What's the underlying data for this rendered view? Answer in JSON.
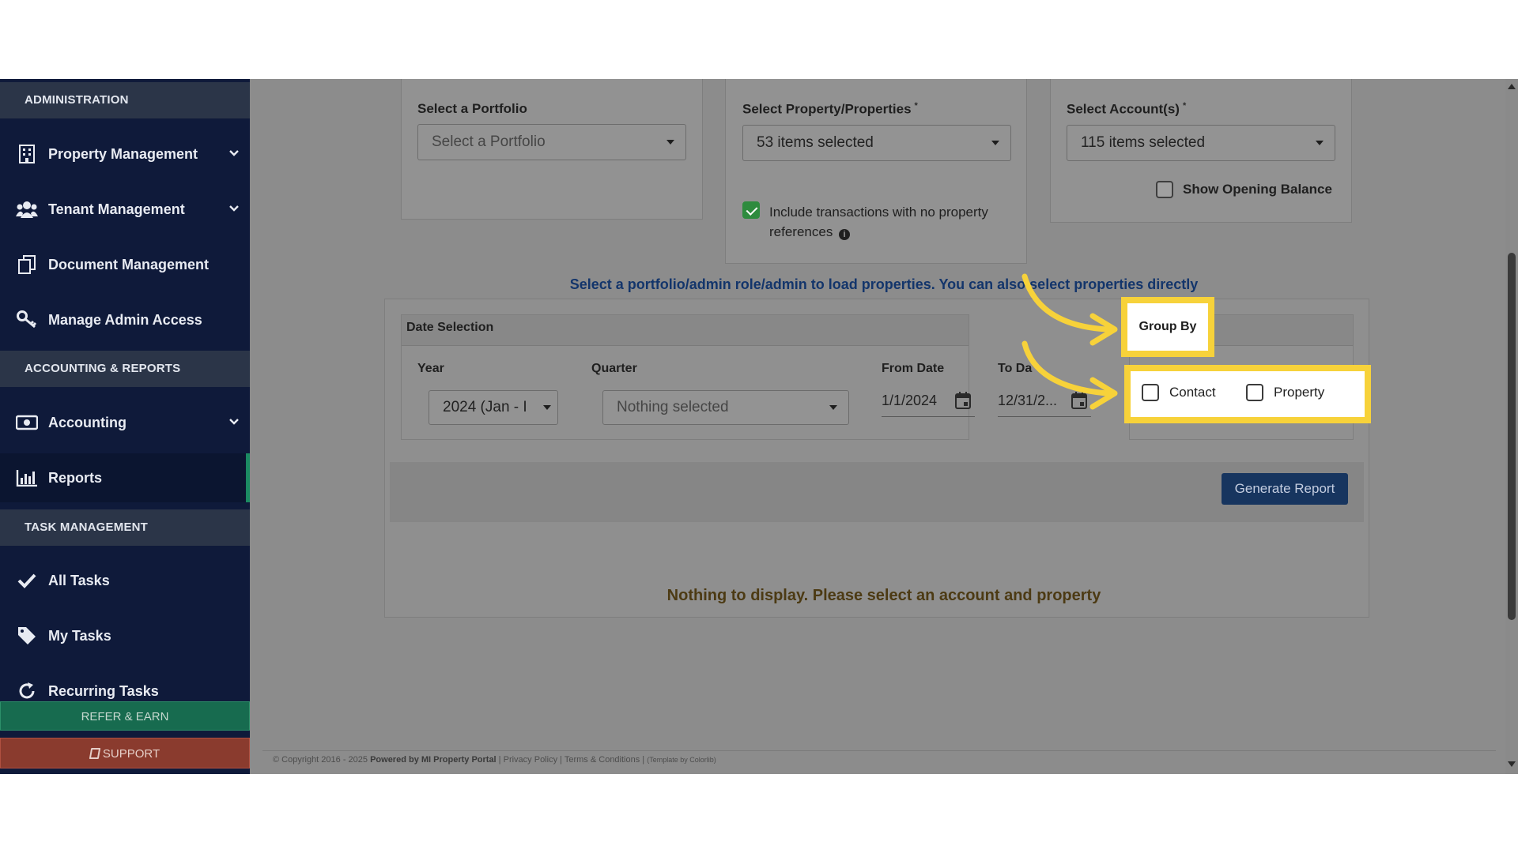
{
  "sidebar": {
    "sections": [
      {
        "title": "ADMINISTRATION"
      },
      {
        "title": "ACCOUNTING & REPORTS"
      },
      {
        "title": "TASK MANAGEMENT"
      }
    ],
    "items": [
      {
        "label": "Property Management",
        "icon": "building-icon",
        "has_chevron": true
      },
      {
        "label": "Tenant Management",
        "icon": "users-icon",
        "has_chevron": true
      },
      {
        "label": "Document Management",
        "icon": "documents-icon",
        "has_chevron": false
      },
      {
        "label": "Manage Admin Access",
        "icon": "key-icon",
        "has_chevron": false
      },
      {
        "label": "Accounting",
        "icon": "money-icon",
        "has_chevron": true
      },
      {
        "label": "Reports",
        "icon": "bar-chart-icon",
        "has_chevron": false,
        "active": true
      },
      {
        "label": "All Tasks",
        "icon": "check-icon",
        "has_chevron": false
      },
      {
        "label": "My Tasks",
        "icon": "tag-icon",
        "has_chevron": false
      },
      {
        "label": "Recurring Tasks",
        "icon": "refresh-icon",
        "has_chevron": false
      }
    ],
    "refer_label": "REFER & EARN",
    "support_label": "SUPPORT"
  },
  "filters": {
    "portfolio": {
      "label": "Select a Portfolio",
      "placeholder": "Select a Portfolio"
    },
    "properties": {
      "label": "Select Property/Properties",
      "required_mark": "*",
      "value": "53 items selected"
    },
    "include_no_property": {
      "label_line1": "Include transactions with no property",
      "label_line2": "references",
      "checked": true
    },
    "accounts": {
      "label": "Select Account(s)",
      "required_mark": "*",
      "value": "115 items selected"
    },
    "opening_balance": {
      "label": "Show Opening Balance",
      "checked": false
    }
  },
  "info_text": "Select a portfolio/admin role/admin to load properties. You can also select properties directly",
  "date_selection": {
    "title": "Date Selection",
    "year": {
      "label": "Year",
      "value": "2024 (Jan - I"
    },
    "quarter": {
      "label": "Quarter",
      "value": "Nothing selected"
    },
    "from_date": {
      "label": "From Date",
      "value": "1/1/2024"
    },
    "to_date": {
      "label": "To Da",
      "value": "12/31/2..."
    }
  },
  "group_by": {
    "title": "Group By",
    "options": [
      {
        "label": "Contact",
        "checked": false
      },
      {
        "label": "Property",
        "checked": false
      }
    ]
  },
  "generate_button": "Generate Report",
  "empty_message": "Nothing to display. Please select an account and property",
  "footer": {
    "copyright": "© Copyright 2016 - 2025",
    "powered_by": "Powered by MI Property Portal",
    "sep1": " | ",
    "privacy": "Privacy Policy",
    "sep2": " | ",
    "terms": "Terms & Conditions",
    "sep3": " | ",
    "template": "(Template by Colorlib)"
  },
  "colors": {
    "sidebar_bg": "#0f1a3a",
    "highlight": "#f7d23a",
    "active_accent": "#1b8a62",
    "refer_bg": "#176b4f",
    "support_bg": "#8a3b2e",
    "primary_button": "#17355f"
  }
}
